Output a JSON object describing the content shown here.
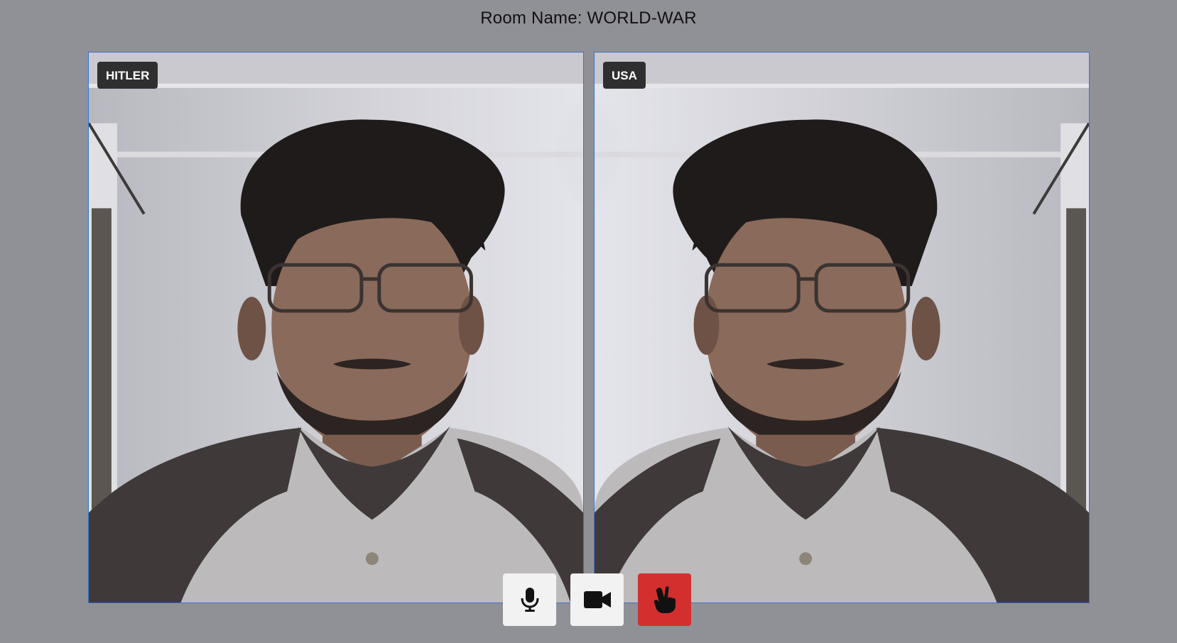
{
  "header": {
    "room_label": "Room Name: WORLD-WAR"
  },
  "participants": [
    {
      "name": "HITLER"
    },
    {
      "name": "USA"
    }
  ],
  "controls": {
    "mic_icon": "microphone-icon",
    "camera_icon": "video-camera-icon",
    "leave_icon": "hand-peace-icon",
    "leave_color": "#d32f2f",
    "button_color": "#f2f2f2"
  },
  "colors": {
    "background": "#909097",
    "tile_border": "#3a74c9",
    "badge_bg": "#2f2f2f"
  }
}
